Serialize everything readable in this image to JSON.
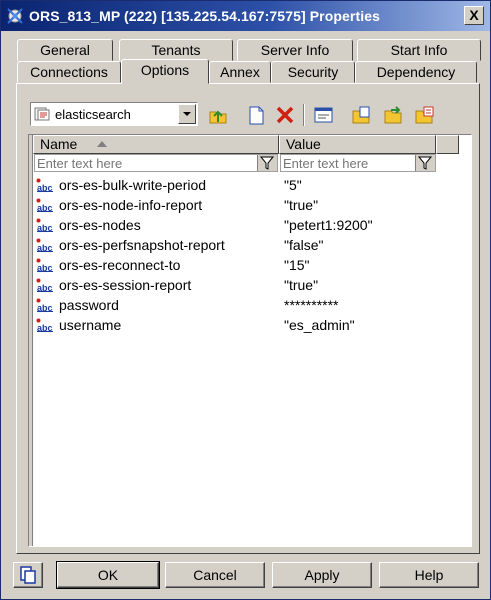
{
  "window": {
    "title": "ORS_813_MP (222) [135.225.54.167:7575] Properties",
    "close_glyph": "X"
  },
  "tabs": {
    "row1": [
      {
        "label": "General"
      },
      {
        "label": "Tenants"
      },
      {
        "label": "Server Info"
      },
      {
        "label": "Start Info"
      }
    ],
    "row2": [
      {
        "label": "Connections"
      },
      {
        "label": "Options",
        "active": true
      },
      {
        "label": "Annex"
      },
      {
        "label": "Security"
      },
      {
        "label": "Dependency"
      }
    ]
  },
  "toolbar": {
    "section_select": {
      "value": "elasticsearch",
      "icon": "section-icon"
    },
    "buttons": [
      {
        "name": "up-level-icon"
      },
      {
        "name": "new-icon"
      },
      {
        "name": "delete-icon"
      },
      {
        "name": "edit-icon"
      },
      {
        "name": "copy-icon"
      },
      {
        "name": "export-icon"
      },
      {
        "name": "import-icon"
      }
    ]
  },
  "grid": {
    "columns": [
      {
        "label": "Name",
        "sorted": "ascending"
      },
      {
        "label": "Value"
      }
    ],
    "filter_placeholder": "Enter text here",
    "rows": [
      {
        "name": "ors-es-bulk-write-period",
        "value": "\"5\""
      },
      {
        "name": "ors-es-node-info-report",
        "value": "\"true\""
      },
      {
        "name": "ors-es-nodes",
        "value": "\"petert1:9200\""
      },
      {
        "name": "ors-es-perfsnapshot-report",
        "value": "\"false\""
      },
      {
        "name": "ors-es-reconnect-to",
        "value": "\"15\""
      },
      {
        "name": "ors-es-session-report",
        "value": "\"true\""
      },
      {
        "name": "password",
        "value": "**********"
      },
      {
        "name": "username",
        "value": "\"es_admin\""
      }
    ]
  },
  "footer": {
    "ok": "OK",
    "cancel": "Cancel",
    "apply": "Apply",
    "help": "Help"
  },
  "colors": {
    "titlebar_start": "#0a2470",
    "titlebar_end": "#9fb8e6",
    "face": "#d4d0c8"
  }
}
